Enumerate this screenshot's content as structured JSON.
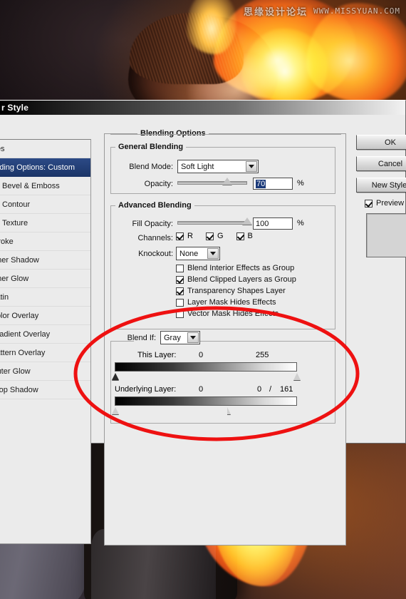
{
  "window": {
    "title": "r Style",
    "full_title": "Layer Style"
  },
  "watermark": {
    "cn": "思缘设计论坛",
    "url": "WWW.MISSYUAN.COM"
  },
  "styles_panel": {
    "items": [
      {
        "label": "yles",
        "checkbox": null,
        "selected": false
      },
      {
        "label": "ending Options: Custom",
        "checkbox": null,
        "selected": true
      },
      {
        "label": "Bevel & Emboss",
        "checkbox": null,
        "selected": false
      },
      {
        "label": "Contour",
        "checkbox": false,
        "selected": false
      },
      {
        "label": "Texture",
        "checkbox": false,
        "selected": false
      },
      {
        "label": "Stroke",
        "checkbox": null,
        "selected": false
      },
      {
        "label": "Inner Shadow",
        "checkbox": null,
        "selected": false
      },
      {
        "label": "Inner Glow",
        "checkbox": null,
        "selected": false
      },
      {
        "label": "Satin",
        "checkbox": null,
        "selected": false
      },
      {
        "label": "Color Overlay",
        "checkbox": null,
        "selected": false
      },
      {
        "label": "Gradient Overlay",
        "checkbox": null,
        "selected": false
      },
      {
        "label": "Pattern Overlay",
        "checkbox": null,
        "selected": false
      },
      {
        "label": "Outer Glow",
        "checkbox": null,
        "selected": false
      },
      {
        "label": "Drop Shadow",
        "checkbox": null,
        "selected": false
      }
    ]
  },
  "blending_options": {
    "group_title": "Blending Options",
    "general": {
      "title": "General Blending",
      "blend_mode_label": "Blend Mode:",
      "blend_mode_value": "Soft Light",
      "opacity_label": "Opacity:",
      "opacity_value": "70",
      "opacity_unit": "%",
      "opacity_percent": 70
    },
    "advanced": {
      "title": "Advanced Blending",
      "fill_opacity_label": "Fill Opacity:",
      "fill_opacity_value": "100",
      "fill_opacity_unit": "%",
      "fill_opacity_percent": 100,
      "channels_label": "Channels:",
      "channels": [
        {
          "label": "R",
          "checked": true
        },
        {
          "label": "G",
          "checked": true
        },
        {
          "label": "B",
          "checked": true
        }
      ],
      "knockout_label": "Knockout:",
      "knockout_value": "None",
      "checkboxes": [
        {
          "label": "Blend Interior Effects as Group",
          "checked": false
        },
        {
          "label": "Blend Clipped Layers as Group",
          "checked": true
        },
        {
          "label": "Transparency Shapes Layer",
          "checked": true
        },
        {
          "label": "Layer Mask Hides Effects",
          "checked": false
        },
        {
          "label": "Vector Mask Hides Effects",
          "checked": false
        }
      ]
    },
    "blend_if": {
      "label": "Blend If:",
      "channel_value": "Gray",
      "this_layer": {
        "label": "This Layer:",
        "black": "0",
        "white": "255",
        "black_pos_pct": 0,
        "white_pos_pct": 100
      },
      "underlying_layer": {
        "label": "Underlying Layer:",
        "black": "0",
        "white_low": "0",
        "white_high": "161",
        "separator": "/",
        "black_pos_pct": 0,
        "white_low_pos_pct": 62,
        "white_high_pos_pct": 63
      }
    }
  },
  "buttons": {
    "ok": "OK",
    "cancel": "Cancel",
    "new_style": "New Style.",
    "preview_label": "Preview",
    "preview_checked": true
  },
  "annotation": {
    "color": "#ee1111",
    "shape": "ellipse",
    "stroke_width": 5
  }
}
